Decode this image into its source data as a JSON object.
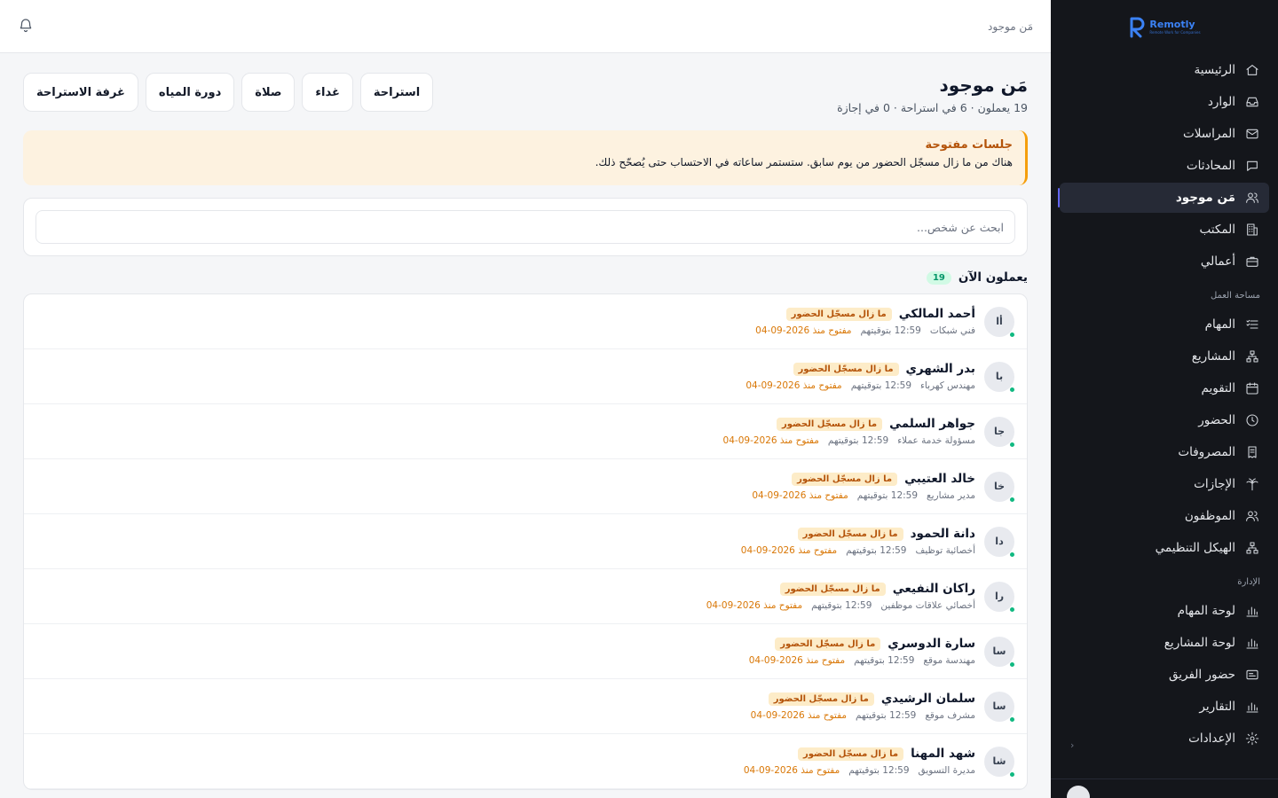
{
  "brand": {
    "name": "Remotly",
    "tagline": "Remote Work for Companies",
    "color": "#3b82f6"
  },
  "sidebar": {
    "primary": [
      {
        "label": "الرئيسية",
        "icon": "home-icon"
      },
      {
        "label": "الوارد",
        "icon": "inbox-icon"
      },
      {
        "label": "المراسلات",
        "icon": "mail-icon"
      },
      {
        "label": "المحادثات",
        "icon": "chat-icon"
      },
      {
        "label": "مَن موجود",
        "icon": "users-icon",
        "active": true
      },
      {
        "label": "المكتب",
        "icon": "building-icon"
      },
      {
        "label": "أعمالي",
        "icon": "briefcase-icon"
      }
    ],
    "workspace_title": "مساحة العمل",
    "workspace": [
      {
        "label": "المهام",
        "icon": "tasks-icon"
      },
      {
        "label": "المشاريع",
        "icon": "network-icon"
      },
      {
        "label": "التقويم",
        "icon": "calendar-icon"
      },
      {
        "label": "الحضور",
        "icon": "clock-icon"
      },
      {
        "label": "المصروفات",
        "icon": "receipt-icon"
      },
      {
        "label": "الإجازات",
        "icon": "palm-icon"
      },
      {
        "label": "الموظفون",
        "icon": "users-icon"
      },
      {
        "label": "الهيكل التنظيمي",
        "icon": "org-chart-icon"
      }
    ],
    "admin_title": "الإدارة",
    "admin": [
      {
        "label": "لوحة المهام",
        "icon": "bar-chart-icon"
      },
      {
        "label": "لوحة المشاريع",
        "icon": "bar-chart-icon"
      },
      {
        "label": "حضور الفريق",
        "icon": "id-card-icon"
      },
      {
        "label": "التقارير",
        "icon": "bar-chart-icon"
      },
      {
        "label": "الإعدادات",
        "icon": "gear-icon"
      }
    ]
  },
  "topbar": {
    "breadcrumb": "مَن موجود"
  },
  "page": {
    "title": "مَن موجود",
    "subtitle": "19 يعملون · 6 في استراحة · 0 في إجازة",
    "status_buttons": [
      "استراحة",
      "غداء",
      "صلاة",
      "دورة المياه",
      "غرفة الاستراحة"
    ]
  },
  "alert": {
    "title": "جلسات مفتوحة",
    "text": "هناك من ما زال مسجّل الحضور من يوم سابق. ستستمر ساعاته في الاحتساب حتى يُصحّح ذلك.",
    "accent": "#f59e0b"
  },
  "search": {
    "placeholder": "ابحث عن شخص..."
  },
  "working": {
    "title": "يعملون الآن",
    "count": "19",
    "people": [
      {
        "initials": "أا",
        "name": "أحمد المالكي",
        "badge": "ما زال مسجّل الحضور",
        "role": "فني شبكات",
        "time": "12:59 بتوقيتهم",
        "open": "مفتوح منذ 2026-09-04"
      },
      {
        "initials": "با",
        "name": "بدر الشهري",
        "badge": "ما زال مسجّل الحضور",
        "role": "مهندس كهرباء",
        "time": "12:59 بتوقيتهم",
        "open": "مفتوح منذ 2026-09-04"
      },
      {
        "initials": "جا",
        "name": "جواهر السلمي",
        "badge": "ما زال مسجّل الحضور",
        "role": "مسؤولة خدمة عملاء",
        "time": "12:59 بتوقيتهم",
        "open": "مفتوح منذ 2026-09-04"
      },
      {
        "initials": "خا",
        "name": "خالد العتيبي",
        "badge": "ما زال مسجّل الحضور",
        "role": "مدير مشاريع",
        "time": "12:59 بتوقيتهم",
        "open": "مفتوح منذ 2026-09-04"
      },
      {
        "initials": "دا",
        "name": "دانة الحمود",
        "badge": "ما زال مسجّل الحضور",
        "role": "أخصائية توظيف",
        "time": "12:59 بتوقيتهم",
        "open": "مفتوح منذ 2026-09-04"
      },
      {
        "initials": "را",
        "name": "راكان النفيعي",
        "badge": "ما زال مسجّل الحضور",
        "role": "أخصائي علاقات موظفين",
        "time": "12:59 بتوقيتهم",
        "open": "مفتوح منذ 2026-09-04"
      },
      {
        "initials": "سا",
        "name": "سارة الدوسري",
        "badge": "ما زال مسجّل الحضور",
        "role": "مهندسة موقع",
        "time": "12:59 بتوقيتهم",
        "open": "مفتوح منذ 2026-09-04"
      },
      {
        "initials": "سا",
        "name": "سلمان الرشيدي",
        "badge": "ما زال مسجّل الحضور",
        "role": "مشرف موقع",
        "time": "12:59 بتوقيتهم",
        "open": "مفتوح منذ 2026-09-04"
      },
      {
        "initials": "شا",
        "name": "شهد المهنا",
        "badge": "ما زال مسجّل الحضور",
        "role": "مديرة التسويق",
        "time": "12:59 بتوقيتهم",
        "open": "مفتوح منذ 2026-09-04"
      }
    ]
  },
  "colors": {
    "sidebar_bg": "#14161b",
    "active_bg": "#262a36",
    "online": "#10b981",
    "warning": "#b45309"
  }
}
